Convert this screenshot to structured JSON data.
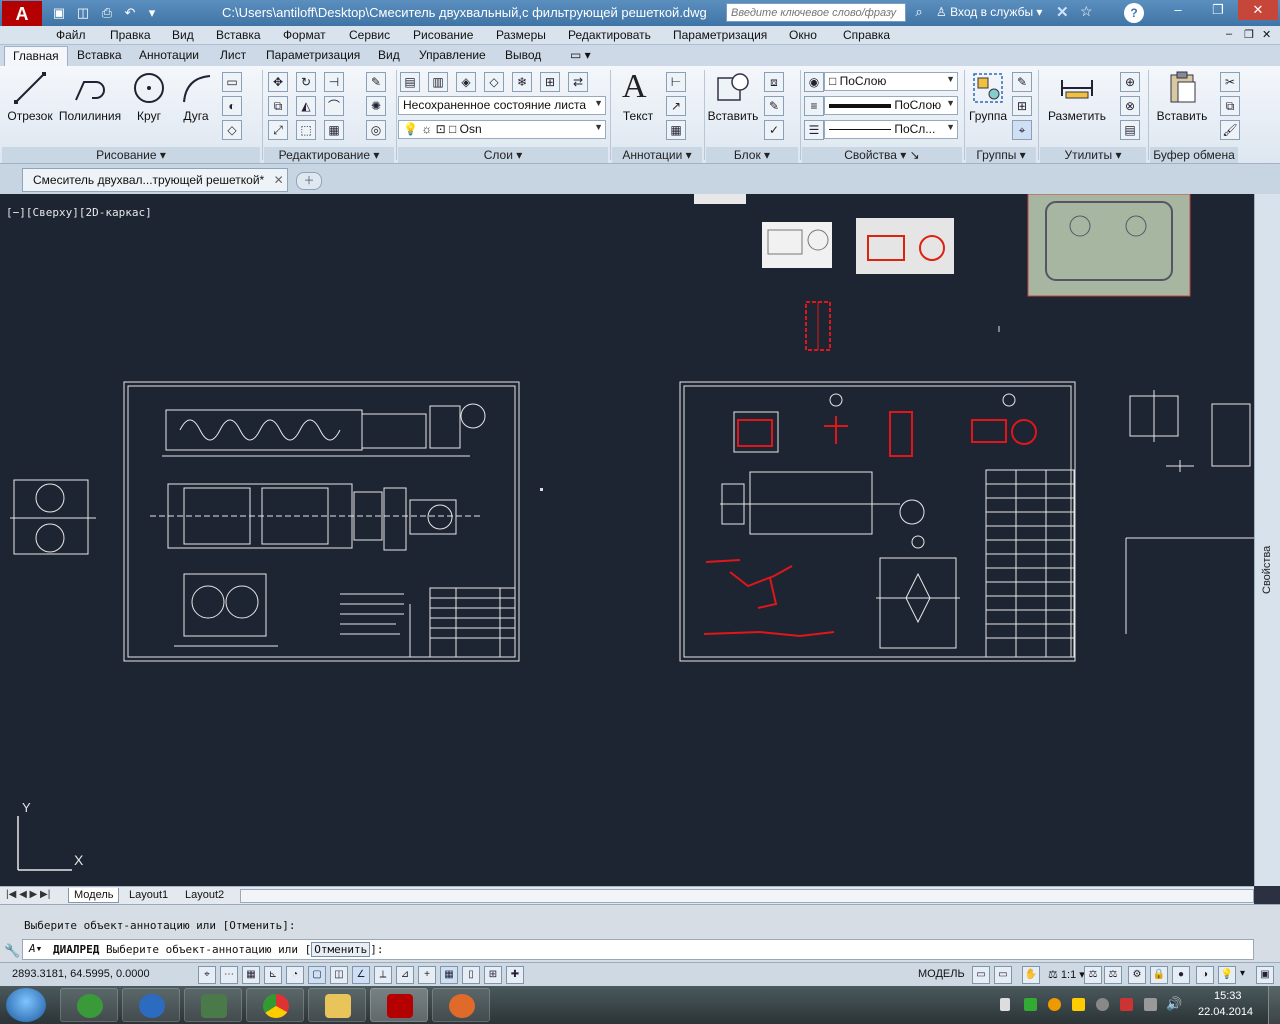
{
  "titlebar": {
    "app_logo": "A",
    "title": "C:\\Users\\antiloff\\Desktop\\Смеситель двухвальный,с фильтрующей решеткой.dwg",
    "search_placeholder": "Введите ключевое слово/фразу",
    "signin": "Вход в службы",
    "help": "?"
  },
  "menu": [
    "Файл",
    "Правка",
    "Вид",
    "Вставка",
    "Формат",
    "Сервис",
    "Рисование",
    "Размеры",
    "Редактировать",
    "Параметризация",
    "Окно",
    "Справка"
  ],
  "ribbon_tabs": [
    "Главная",
    "Вставка",
    "Аннотации",
    "Лист",
    "Параметризация",
    "Вид",
    "Управление",
    "Вывод"
  ],
  "ribbon": {
    "draw": {
      "line": "Отрезок",
      "polyline": "Полилиния",
      "circle": "Круг",
      "arc": "Дуга",
      "panel": "Рисование"
    },
    "modify": {
      "panel": "Редактирование"
    },
    "layers": {
      "state": "Несохраненное состояние листа",
      "current_layer": "Osn",
      "panel": "Слои"
    },
    "annotation": {
      "text": "Текст",
      "panel": "Аннотации"
    },
    "block": {
      "insert": "Вставить",
      "panel": "Блок"
    },
    "properties": {
      "color": "ПоСлою",
      "lineweight": "ПоСлою",
      "linetype": "ПоСл...",
      "panel": "Свойства"
    },
    "groups": {
      "group": "Группа",
      "panel": "Группы"
    },
    "utilities": {
      "measure": "Разметить",
      "panel": "Утилиты"
    },
    "clipboard": {
      "paste": "Вставить",
      "panel": "Буфер обмена"
    }
  },
  "doc_tab": "Смеситель двухвал...трующей решеткой*",
  "viewport": {
    "label": "[−][Сверху][2D-каркас]",
    "ucs_x": "X",
    "ucs_y": "Y"
  },
  "side_palette": "Свойства",
  "layout_tabs": [
    "Модель",
    "Layout1",
    "Layout2"
  ],
  "command": {
    "history": "Выберите объект-аннотацию или [Отменить]:",
    "name": "ДИАЛРЕД",
    "prompt": "Выберите объект-аннотацию или [",
    "option": "Отменить",
    "prompt_end": "]:"
  },
  "status": {
    "coords": "2893.3181, 64.5995, 0.0000",
    "model": "МОДЕЛЬ",
    "scale": "1:1"
  },
  "taskbar": {
    "time": "15:33",
    "date": "22.04.2014"
  },
  "colors": {
    "viewport_bg": "#1d2532",
    "drawing_line": "#e6e6e6",
    "drawing_red": "#e0161a",
    "title_bar": "#4a80b3"
  }
}
